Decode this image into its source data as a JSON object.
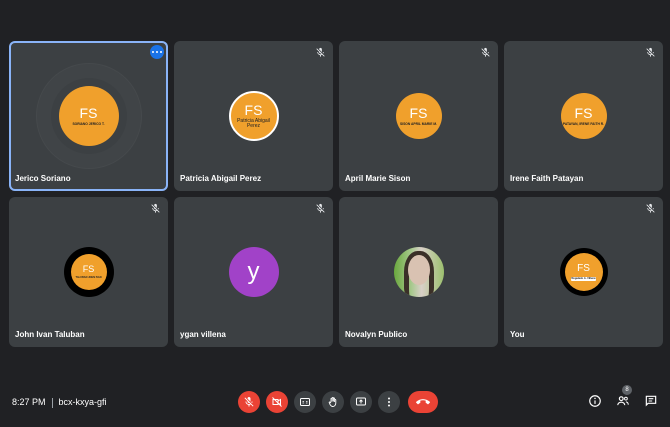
{
  "participants": [
    {
      "name": "Jerico Soriano",
      "initials": "FS",
      "caption": "SORIANO JERICO T.",
      "muted": false
    },
    {
      "name": "Patricia Abigail Perez",
      "initials": "FS",
      "caption": "Patricia Abigail Perez",
      "muted": true
    },
    {
      "name": "April Marie Sison",
      "initials": "FS",
      "caption": "SISON APRIL MARIE M.",
      "muted": true
    },
    {
      "name": "Irene Faith Patayan",
      "initials": "FS",
      "caption": "PATAYAN, IRENE FAITH R.",
      "muted": true
    },
    {
      "name": "John Ivan Taluban",
      "initials": "FS",
      "caption": "TALUBAN JOHN IVAN",
      "muted": true
    },
    {
      "name": "ygan villena",
      "letter": "y",
      "muted": true
    },
    {
      "name": "Novalyn Publico",
      "muted": false
    },
    {
      "name": "You",
      "initials": "FS",
      "caption": "Regalado A. Villena",
      "muted": true
    }
  ],
  "meeting": {
    "time": "8:27 PM",
    "code": "bcx-kxya-gfi"
  },
  "people_count": "8",
  "colors": {
    "background": "#202124",
    "tile": "#3c4043",
    "accent_blue": "#8ab4f8",
    "danger_red": "#ea4335",
    "avatar_orange": "#f0a02c",
    "avatar_purple": "#a142c8"
  },
  "icons": {
    "mute": "mic-off-icon",
    "more": "more-options-icon",
    "controls": [
      "mic-off-icon",
      "camera-off-icon",
      "captions-icon",
      "raise-hand-icon",
      "present-icon",
      "more-vert-icon",
      "end-call-icon"
    ],
    "right": [
      "info-icon",
      "people-icon",
      "chat-icon"
    ]
  }
}
